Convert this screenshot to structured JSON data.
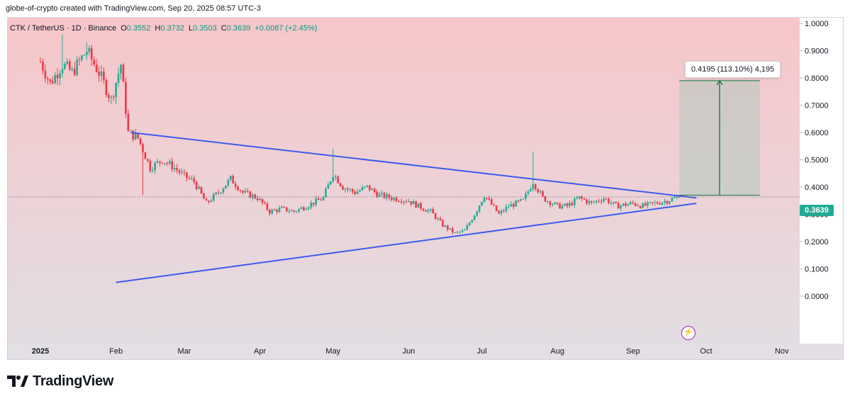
{
  "header": {
    "caption": "globe-of-crypto created with TradingView.com, Sep 20, 2025 08:57 UTC-3"
  },
  "legend": {
    "symbol": "CTK / TetherUS · 1D · Binance",
    "open_label": "O",
    "open": "0.3552",
    "high_label": "H",
    "high": "0.3732",
    "low_label": "L",
    "low": "0.3503",
    "close_label": "C",
    "close": "0.3639",
    "change": "+0.0087 (+2.45%)"
  },
  "measure": {
    "text": "0.4195 (113.10%) 4,195"
  },
  "last_price": "0.3639",
  "footer": {
    "brand": "TradingView"
  },
  "colors": {
    "up": "#22ab94",
    "down": "#f23645",
    "trendline": "#3d5af1",
    "measure_fill": "#b2c8c0",
    "measure_arrow": "#0b7a3e",
    "bg_top": "#f7c6c9",
    "bg_bottom": "#e2dde2"
  },
  "chart_data": {
    "type": "candlestick",
    "title": "CTK / TetherUS · 1D · Binance",
    "y_axis": {
      "min": -0.06,
      "max": 1.0,
      "ticks": [
        "1.0000",
        "0.9000",
        "0.8000",
        "0.7000",
        "0.6000",
        "0.5000",
        "0.4000",
        "0.3000",
        "0.2000",
        "0.1000",
        "0.0000"
      ]
    },
    "x_axis": {
      "tick_labels": [
        "2025",
        "Feb",
        "Mar",
        "Apr",
        "May",
        "Jun",
        "Jul",
        "Aug",
        "Sep",
        "Oct",
        "Nov"
      ]
    },
    "price_path": [
      {
        "date": "2025-01-01",
        "price": 0.86
      },
      {
        "date": "2025-01-05",
        "price": 0.78
      },
      {
        "date": "2025-01-10",
        "price": 0.85
      },
      {
        "date": "2025-01-14",
        "price": 0.82
      },
      {
        "date": "2025-01-20",
        "price": 0.9
      },
      {
        "date": "2025-01-25",
        "price": 0.82
      },
      {
        "date": "2025-01-30",
        "price": 0.72
      },
      {
        "date": "2025-02-03",
        "price": 0.85
      },
      {
        "date": "2025-02-06",
        "price": 0.6
      },
      {
        "date": "2025-02-10",
        "price": 0.58
      },
      {
        "date": "2025-02-15",
        "price": 0.47
      },
      {
        "date": "2025-02-20",
        "price": 0.5
      },
      {
        "date": "2025-02-25",
        "price": 0.47
      },
      {
        "date": "2025-03-01",
        "price": 0.44
      },
      {
        "date": "2025-03-05",
        "price": 0.42
      },
      {
        "date": "2025-03-10",
        "price": 0.34
      },
      {
        "date": "2025-03-15",
        "price": 0.38
      },
      {
        "date": "2025-03-20",
        "price": 0.43
      },
      {
        "date": "2025-03-25",
        "price": 0.38
      },
      {
        "date": "2025-03-31",
        "price": 0.36
      },
      {
        "date": "2025-04-05",
        "price": 0.31
      },
      {
        "date": "2025-04-10",
        "price": 0.32
      },
      {
        "date": "2025-04-15",
        "price": 0.31
      },
      {
        "date": "2025-04-20",
        "price": 0.33
      },
      {
        "date": "2025-04-27",
        "price": 0.36
      },
      {
        "date": "2025-05-01",
        "price": 0.45
      },
      {
        "date": "2025-05-05",
        "price": 0.4
      },
      {
        "date": "2025-05-10",
        "price": 0.38
      },
      {
        "date": "2025-05-15",
        "price": 0.4
      },
      {
        "date": "2025-05-20",
        "price": 0.37
      },
      {
        "date": "2025-05-25",
        "price": 0.36
      },
      {
        "date": "2025-06-01",
        "price": 0.35
      },
      {
        "date": "2025-06-05",
        "price": 0.33
      },
      {
        "date": "2025-06-10",
        "price": 0.31
      },
      {
        "date": "2025-06-15",
        "price": 0.26
      },
      {
        "date": "2025-06-20",
        "price": 0.23
      },
      {
        "date": "2025-06-24",
        "price": 0.24
      },
      {
        "date": "2025-06-28",
        "price": 0.3
      },
      {
        "date": "2025-07-02",
        "price": 0.37
      },
      {
        "date": "2025-07-08",
        "price": 0.3
      },
      {
        "date": "2025-07-12",
        "price": 0.33
      },
      {
        "date": "2025-07-18",
        "price": 0.35
      },
      {
        "date": "2025-07-22",
        "price": 0.42
      },
      {
        "date": "2025-07-26",
        "price": 0.36
      },
      {
        "date": "2025-08-01",
        "price": 0.33
      },
      {
        "date": "2025-08-05",
        "price": 0.33
      },
      {
        "date": "2025-08-10",
        "price": 0.36
      },
      {
        "date": "2025-08-15",
        "price": 0.34
      },
      {
        "date": "2025-08-20",
        "price": 0.36
      },
      {
        "date": "2025-08-25",
        "price": 0.33
      },
      {
        "date": "2025-09-01",
        "price": 0.34
      },
      {
        "date": "2025-09-05",
        "price": 0.33
      },
      {
        "date": "2025-09-10",
        "price": 0.34
      },
      {
        "date": "2025-09-15",
        "price": 0.35
      },
      {
        "date": "2025-09-20",
        "price": 0.3639
      }
    ],
    "spikes": [
      {
        "date": "2025-01-10",
        "high": 0.96
      },
      {
        "date": "2025-01-20",
        "high": 0.93
      },
      {
        "date": "2025-05-01",
        "high": 0.54
      },
      {
        "date": "2025-07-22",
        "high": 0.53
      },
      {
        "date": "2025-02-12",
        "low": 0.37
      }
    ],
    "trendlines": [
      {
        "name": "descending resistance",
        "from": {
          "date": "2025-02-07",
          "price": 0.6
        },
        "to": {
          "date": "2025-09-27",
          "price": 0.36
        }
      },
      {
        "name": "ascending support",
        "from": {
          "date": "2025-02-01",
          "price": 0.05
        },
        "to": {
          "date": "2025-09-27",
          "price": 0.34
        }
      }
    ],
    "measured_move": {
      "from_date": "2025-09-20",
      "to_date": "2025-10-23",
      "from_price": 0.37,
      "to_price": 0.79,
      "label": "0.4195 (113.10%) 4,195"
    },
    "last_price": 0.3639,
    "grid": false
  }
}
